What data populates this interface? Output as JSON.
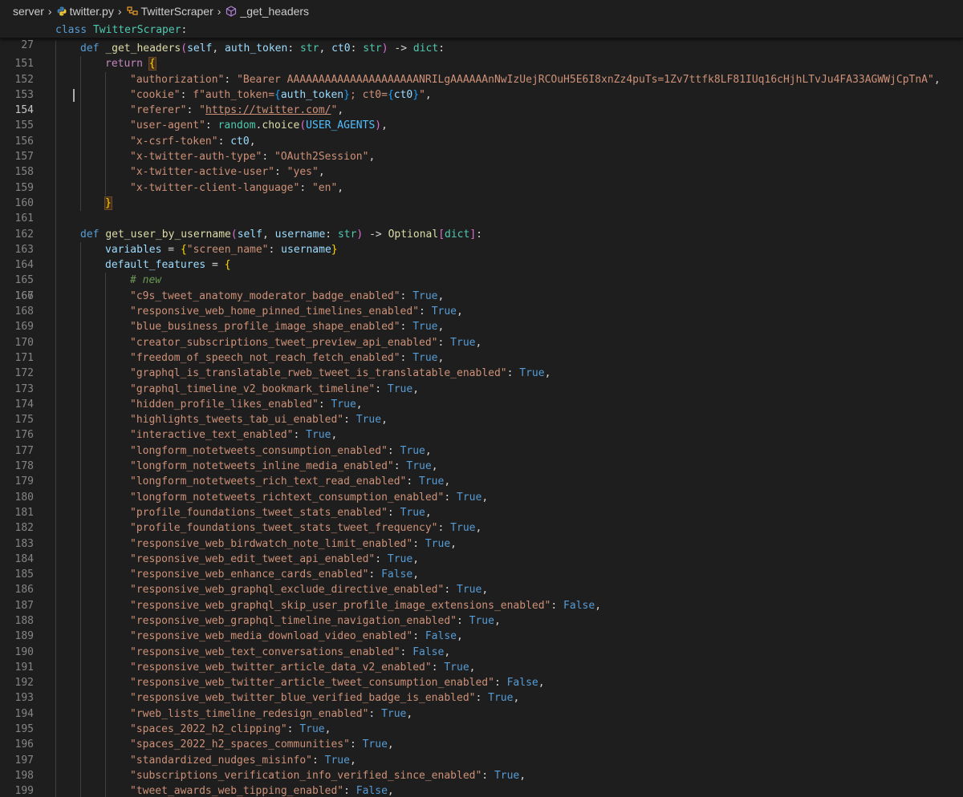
{
  "breadcrumb": {
    "items": [
      {
        "label": "server",
        "icon": "folder"
      },
      {
        "label": "twitter.py",
        "icon": "python-file-icon"
      },
      {
        "label": "TwitterScraper",
        "icon": "class-icon"
      },
      {
        "label": "_get_headers",
        "icon": "method-icon"
      }
    ]
  },
  "sticky": {
    "line_number": "27",
    "keyword": "class",
    "class_name": "TwitterScraper",
    "colon": ":"
  },
  "editor": {
    "active_line": "154",
    "line_numbers": [
      "151",
      "152",
      "153",
      "154",
      "155",
      "156",
      "157",
      "158",
      "159",
      "160",
      "161",
      "162",
      "163",
      "164",
      "165",
      "166",
      "167",
      "168",
      "169",
      "170",
      "171",
      "172",
      "173",
      "174",
      "175",
      "176",
      "177",
      "178",
      "179",
      "180",
      "181",
      "182",
      "183",
      "184",
      "185",
      "186",
      "187",
      "188",
      "189",
      "190",
      "191",
      "192",
      "193",
      "194",
      "195",
      "196",
      "197",
      "198",
      "199"
    ],
    "headers": {
      "def_kw": "def",
      "fn_name": "_get_headers",
      "params": "(self, auth_token: str, ct0: str) -> dict:",
      "return_kw": "return",
      "authorization_key": "\"authorization\"",
      "authorization_val": "\"Bearer AAAAAAAAAAAAAAAAAAAAANRILgAAAAAAnNwIzUejRCOuH5E6I8xnZz4puTs=1Zv7ttfk8LF81IUq16cHjhLTvJu4FA33AGWWjCpTnA\"",
      "cookie_key": "\"cookie\"",
      "cookie_prefix": "f\"auth_token=",
      "cookie_auth": "auth_token",
      "cookie_mid": "; ct0=",
      "cookie_ct0": "ct0",
      "referer_key": "\"referer\"",
      "referer_val": "https://twitter.com/",
      "ua_key": "\"user-agent\"",
      "ua_obj": "random",
      "ua_fn": "choice",
      "ua_const": "USER_AGENTS",
      "csrf_key": "\"x-csrf-token\"",
      "csrf_val": "ct0",
      "auth_type_key": "\"x-twitter-auth-type\"",
      "auth_type_val": "\"OAuth2Session\"",
      "active_user_key": "\"x-twitter-active-user\"",
      "active_user_val": "\"yes\"",
      "client_lang_key": "\"x-twitter-client-language\"",
      "client_lang_val": "\"en\""
    },
    "get_user": {
      "def_kw": "def",
      "fn_name": "get_user_by_username",
      "self": "self",
      "username": "username",
      "str": "str",
      "optional": "Optional",
      "dict": "dict",
      "variables": "variables",
      "screen_name_key": "\"screen_name\"",
      "username_val": "username",
      "default_features": "default_features",
      "comment": "# new"
    },
    "features": [
      {
        "key": "\"c9s_tweet_anatomy_moderator_badge_enabled\"",
        "value": "True"
      },
      {
        "key": "\"responsive_web_home_pinned_timelines_enabled\"",
        "value": "True"
      },
      {
        "key": "\"blue_business_profile_image_shape_enabled\"",
        "value": "True"
      },
      {
        "key": "\"creator_subscriptions_tweet_preview_api_enabled\"",
        "value": "True"
      },
      {
        "key": "\"freedom_of_speech_not_reach_fetch_enabled\"",
        "value": "True"
      },
      {
        "key": "\"graphql_is_translatable_rweb_tweet_is_translatable_enabled\"",
        "value": "True"
      },
      {
        "key": "\"graphql_timeline_v2_bookmark_timeline\"",
        "value": "True"
      },
      {
        "key": "\"hidden_profile_likes_enabled\"",
        "value": "True"
      },
      {
        "key": "\"highlights_tweets_tab_ui_enabled\"",
        "value": "True"
      },
      {
        "key": "\"interactive_text_enabled\"",
        "value": "True"
      },
      {
        "key": "\"longform_notetweets_consumption_enabled\"",
        "value": "True"
      },
      {
        "key": "\"longform_notetweets_inline_media_enabled\"",
        "value": "True"
      },
      {
        "key": "\"longform_notetweets_rich_text_read_enabled\"",
        "value": "True"
      },
      {
        "key": "\"longform_notetweets_richtext_consumption_enabled\"",
        "value": "True"
      },
      {
        "key": "\"profile_foundations_tweet_stats_enabled\"",
        "value": "True"
      },
      {
        "key": "\"profile_foundations_tweet_stats_tweet_frequency\"",
        "value": "True"
      },
      {
        "key": "\"responsive_web_birdwatch_note_limit_enabled\"",
        "value": "True"
      },
      {
        "key": "\"responsive_web_edit_tweet_api_enabled\"",
        "value": "True"
      },
      {
        "key": "\"responsive_web_enhance_cards_enabled\"",
        "value": "False"
      },
      {
        "key": "\"responsive_web_graphql_exclude_directive_enabled\"",
        "value": "True"
      },
      {
        "key": "\"responsive_web_graphql_skip_user_profile_image_extensions_enabled\"",
        "value": "False"
      },
      {
        "key": "\"responsive_web_graphql_timeline_navigation_enabled\"",
        "value": "True"
      },
      {
        "key": "\"responsive_web_media_download_video_enabled\"",
        "value": "False"
      },
      {
        "key": "\"responsive_web_text_conversations_enabled\"",
        "value": "False"
      },
      {
        "key": "\"responsive_web_twitter_article_data_v2_enabled\"",
        "value": "True"
      },
      {
        "key": "\"responsive_web_twitter_article_tweet_consumption_enabled\"",
        "value": "False"
      },
      {
        "key": "\"responsive_web_twitter_blue_verified_badge_is_enabled\"",
        "value": "True"
      },
      {
        "key": "\"rweb_lists_timeline_redesign_enabled\"",
        "value": "True"
      },
      {
        "key": "\"spaces_2022_h2_clipping\"",
        "value": "True"
      },
      {
        "key": "\"spaces_2022_h2_spaces_communities\"",
        "value": "True"
      },
      {
        "key": "\"standardized_nudges_misinfo\"",
        "value": "True"
      },
      {
        "key": "\"subscriptions_verification_info_verified_since_enabled\"",
        "value": "True"
      },
      {
        "key": "\"tweet_awards_web_tipping_enabled\"",
        "value": "False"
      }
    ]
  },
  "colors": {
    "background": "#1e1e1e",
    "keyword": "#569cd6",
    "control": "#c586c0",
    "function": "#dcdcaa",
    "class": "#4ec9b0",
    "variable": "#9cdcfe",
    "string": "#ce9178",
    "comment": "#6a9955"
  }
}
